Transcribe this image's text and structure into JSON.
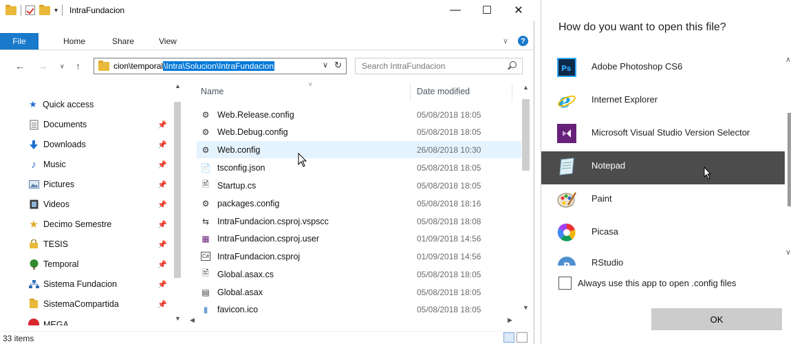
{
  "explorer": {
    "title": "IntraFundacion",
    "ribbon": {
      "file": "File",
      "home": "Home",
      "share": "Share",
      "view": "View"
    },
    "address": {
      "plain": "cion\\temporal",
      "selected": "\\Intra\\Solucion\\IntraFundacion"
    },
    "search_placeholder": "Search IntraFundacion",
    "nav": [
      {
        "label": "Quick access",
        "icon": "star-icon",
        "pinned": false
      },
      {
        "label": "Documents",
        "icon": "documents-icon",
        "pinned": true
      },
      {
        "label": "Downloads",
        "icon": "downloads-icon",
        "pinned": true
      },
      {
        "label": "Music",
        "icon": "music-icon",
        "pinned": true
      },
      {
        "label": "Pictures",
        "icon": "pictures-icon",
        "pinned": true
      },
      {
        "label": "Videos",
        "icon": "videos-icon",
        "pinned": true
      },
      {
        "label": "Decimo Semestre",
        "icon": "shared-folder-icon",
        "pinned": true
      },
      {
        "label": "TESIS",
        "icon": "lock-folder-icon",
        "pinned": true
      },
      {
        "label": "Temporal",
        "icon": "tree-icon",
        "pinned": true
      },
      {
        "label": "Sistema Fundacion",
        "icon": "network-icon",
        "pinned": true
      },
      {
        "label": "SistemaCompartida",
        "icon": "folder-icon",
        "pinned": true
      },
      {
        "label": "MEGA",
        "icon": "mega-icon",
        "pinned": false
      }
    ],
    "columns": {
      "name": "Name",
      "date": "Date modified"
    },
    "files": [
      {
        "name": "Web.Release.config",
        "date": "05/08/2018 18:05",
        "icon": "config-icon"
      },
      {
        "name": "Web.Debug.config",
        "date": "05/08/2018 18:05",
        "icon": "config-icon"
      },
      {
        "name": "Web.config",
        "date": "26/08/2018 10:30",
        "icon": "config-icon"
      },
      {
        "name": "tsconfig.json",
        "date": "05/08/2018 18:05",
        "icon": "json-icon"
      },
      {
        "name": "Startup.cs",
        "date": "05/08/2018 18:05",
        "icon": "text-file-icon"
      },
      {
        "name": "packages.config",
        "date": "05/08/2018 18:16",
        "icon": "config-icon"
      },
      {
        "name": "IntraFundacion.csproj.vspscc",
        "date": "05/08/2018 18:08",
        "icon": "sync-icon"
      },
      {
        "name": "IntraFundacion.csproj.user",
        "date": "01/09/2018 14:56",
        "icon": "vs-user-icon"
      },
      {
        "name": "IntraFundacion.csproj",
        "date": "01/09/2018 14:56",
        "icon": "csharp-project-icon"
      },
      {
        "name": "Global.asax.cs",
        "date": "05/08/2018 18:05",
        "icon": "text-file-icon"
      },
      {
        "name": "Global.asax",
        "date": "05/08/2018 18:05",
        "icon": "asax-icon"
      },
      {
        "name": "favicon.ico",
        "date": "05/08/2018 18:05",
        "icon": "image-file-icon"
      }
    ],
    "status": "33 items"
  },
  "openwith": {
    "title": "How do you want to open this file?",
    "apps": [
      {
        "label": "",
        "icon": "partial-app-icon"
      },
      {
        "label": "Adobe Photoshop CS6",
        "icon": "photoshop-icon"
      },
      {
        "label": "Internet Explorer",
        "icon": "internet-explorer-icon"
      },
      {
        "label": "Microsoft Visual Studio Version Selector",
        "icon": "visual-studio-icon"
      },
      {
        "label": "Notepad",
        "icon": "notepad-icon"
      },
      {
        "label": "Paint",
        "icon": "paint-icon"
      },
      {
        "label": "Picasa",
        "icon": "picasa-icon"
      },
      {
        "label": "RStudio",
        "icon": "rstudio-icon"
      }
    ],
    "always_label": "Always use this app to open .config files",
    "ok_label": "OK"
  }
}
